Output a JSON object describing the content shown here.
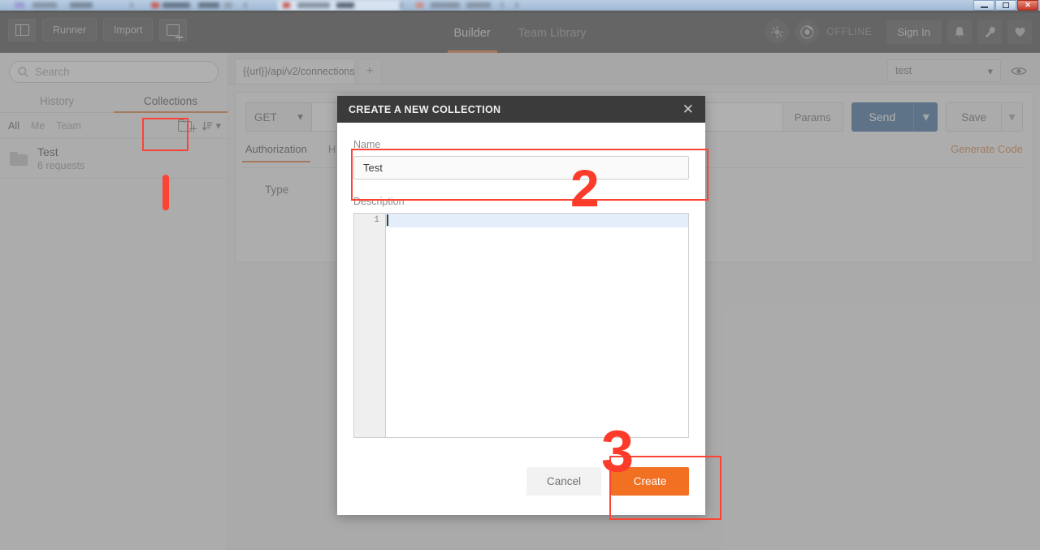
{
  "window": {
    "controls": [
      "minimize",
      "restore",
      "close"
    ]
  },
  "header": {
    "sidebar_toggle_icon": "panel-toggle-icon",
    "runner_label": "Runner",
    "import_label": "Import",
    "new_tab_icon": "new-window-icon",
    "tabs": [
      {
        "label": "Builder",
        "active": true
      },
      {
        "label": "Team Library",
        "active": false
      }
    ],
    "interceptor_icon": "interceptor-icon",
    "sync_icon": "sync-status-icon",
    "status_label": "OFFLINE",
    "signin_label": "Sign In",
    "bell_icon": "bell-icon",
    "wrench_icon": "wrench-icon",
    "heart_icon": "heart-icon"
  },
  "sidebar": {
    "search_placeholder": "Search",
    "search_icon": "search-icon",
    "tabs": [
      {
        "label": "History",
        "active": false
      },
      {
        "label": "Collections",
        "active": true
      }
    ],
    "filters": [
      {
        "label": "All",
        "active": true
      },
      {
        "label": "Me",
        "active": false
      },
      {
        "label": "Team",
        "active": false
      }
    ],
    "new_collection_icon": "folder-plus-icon",
    "sort_icon": "sort-descending-icon",
    "collections": [
      {
        "name": "Test",
        "meta": "6 requests",
        "icon": "folder-icon"
      }
    ]
  },
  "main": {
    "request_tab_label": "{{url}}/api/v2/connections",
    "new_request_tab_label": "+",
    "environment_value": "test",
    "environment_caret_icon": "chevron-down-icon",
    "eye_icon": "eye-icon",
    "method_label": "GET",
    "method_caret_icon": "chevron-down-icon",
    "url_value": "",
    "params_label": "Params",
    "send_label": "Send",
    "send_caret_icon": "chevron-down-icon",
    "save_label": "Save",
    "save_caret_icon": "chevron-down-icon",
    "generate_code_label": "Generate Code",
    "subtabs": [
      {
        "label": "Authorization",
        "active": true
      },
      {
        "label": "H",
        "active": false
      }
    ],
    "type_label": "Type"
  },
  "modal": {
    "title": "CREATE A NEW COLLECTION",
    "close_icon": "close-icon",
    "name_label": "Name",
    "name_value": "Test",
    "description_label": "Description",
    "description_line_number": "1",
    "description_value": "",
    "cancel_label": "Cancel",
    "create_label": "Create"
  },
  "annotations": {
    "color": "#fc4435",
    "steps": [
      {
        "id": "1",
        "label": "",
        "target": "new-collection-icon"
      },
      {
        "id": "2",
        "label": "2",
        "target": "name-field"
      },
      {
        "id": "3",
        "label": "3",
        "target": "create-button"
      }
    ]
  }
}
